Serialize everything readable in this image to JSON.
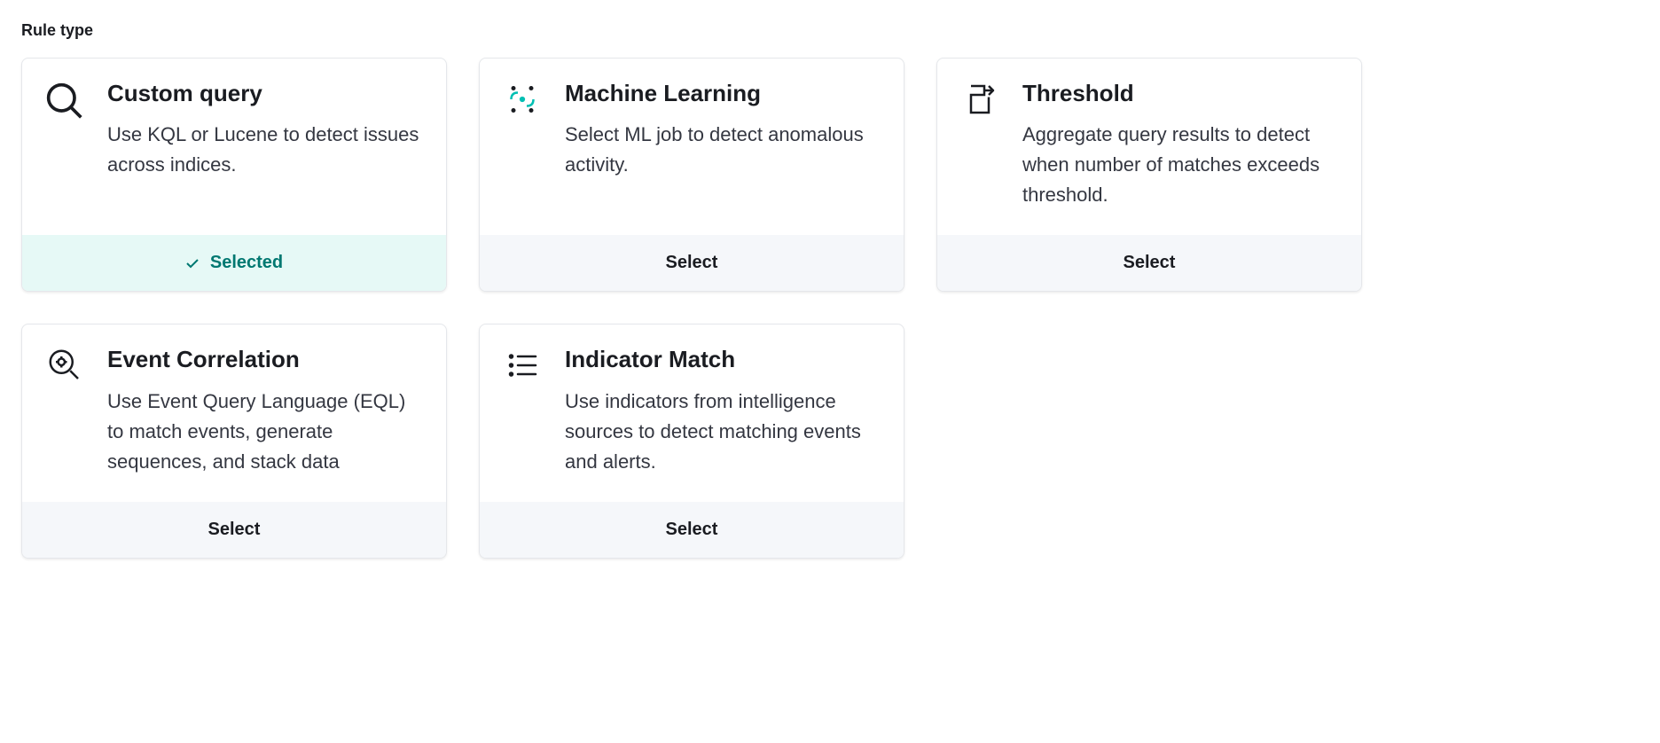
{
  "section_label": "Rule type",
  "cards": [
    {
      "id": "custom-query",
      "title": "Custom query",
      "description": "Use KQL or Lucene to detect issues across indices.",
      "selected": true,
      "button_label": "Selected"
    },
    {
      "id": "machine-learning",
      "title": "Machine Learning",
      "description": "Select ML job to detect anomalous activity.",
      "selected": false,
      "button_label": "Select"
    },
    {
      "id": "threshold",
      "title": "Threshold",
      "description": "Aggregate query results to detect when number of matches exceeds threshold.",
      "selected": false,
      "button_label": "Select"
    },
    {
      "id": "event-correlation",
      "title": "Event Correlation",
      "description": "Use Event Query Language (EQL) to match events, generate sequences, and stack data",
      "selected": false,
      "button_label": "Select"
    },
    {
      "id": "indicator-match",
      "title": "Indicator Match",
      "description": "Use indicators from intelligence sources to detect matching events and alerts.",
      "selected": false,
      "button_label": "Select"
    }
  ]
}
